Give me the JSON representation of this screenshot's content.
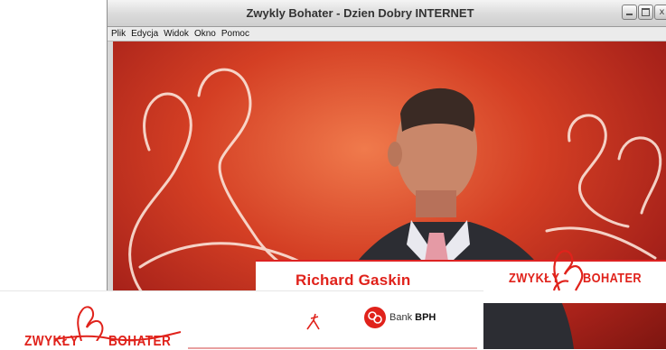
{
  "window": {
    "title": "Zwykly Bohater - Dzien Dobry INTERNET",
    "controls": {
      "minimize": "minimize",
      "maximize": "maximize",
      "close": "x"
    }
  },
  "menu": [
    "Plik",
    "Edycja",
    "Widok",
    "Okno",
    "Pomoc"
  ],
  "video": {
    "speaker_name": "Richard Gaskin",
    "logo_word1": "ZWYKŁY",
    "logo_word2": "BOHATER"
  },
  "banner": {
    "logo_word1": "ZWYKŁY",
    "logo_word2": "BOHATER",
    "bank_prefix": "Bank",
    "bank_name": "BPH"
  },
  "colors": {
    "brand_red": "#e0221b",
    "studio_red": "#d43f24"
  },
  "icons": [
    "minimize-icon",
    "maximize-icon",
    "close-icon",
    "bank-bph-logo-icon"
  ]
}
